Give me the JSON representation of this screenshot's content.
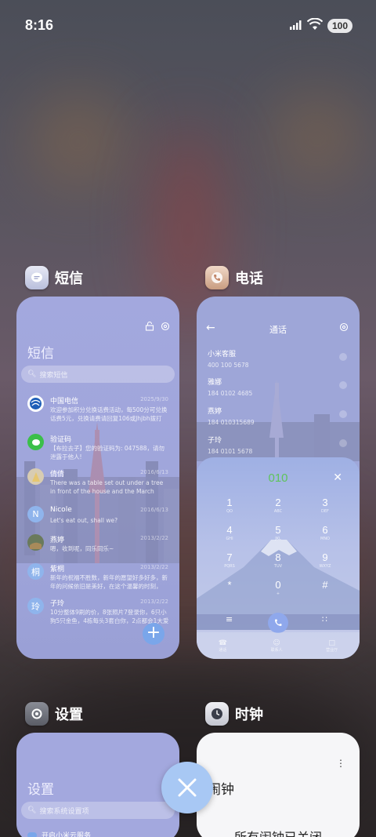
{
  "status_bar": {
    "time": "8:16",
    "battery": "100"
  },
  "apps": {
    "sms": {
      "name": "短信",
      "title": "短信",
      "search_placeholder": "搜索短信",
      "messages": [
        {
          "name": "中国电信",
          "date": "2025/9/30",
          "preview": "欢迎参加积分兑换话费活动，每500分可兑换话费5元，兑换请费请回复106或Jhjbh拨打",
          "avatar_text": "",
          "avatar_color": "#1f5fb8"
        },
        {
          "name": "验证码",
          "date": "",
          "preview": "【布拉去子】您的验证码为: 047588，请勿泄露于他人!",
          "avatar_text": "",
          "avatar_color": "#3bbf4a"
        },
        {
          "name": "倩倩",
          "date": "2016/6/13",
          "preview": "There was a table set out under a tree in front of the house and the March Hare and",
          "avatar_text": "",
          "avatar_color": "#c9b99b"
        },
        {
          "name": "Nicole",
          "date": "2016/6/13",
          "preview": "Let's eat out, shall we?",
          "avatar_text": "N",
          "avatar_color": "#8fb4ec"
        },
        {
          "name": "燕婷",
          "date": "2013/2/22",
          "preview": "嗯，收到呢，同乐同乐~",
          "avatar_text": "",
          "avatar_color": "#6a7a5c"
        },
        {
          "name": "紫桐",
          "date": "2013/2/22",
          "preview": "新年的祝福不胜数，新年的愿望好多好多，新年的问候依旧是美好，在这个温馨的时刻，",
          "avatar_text": "桐",
          "avatar_color": "#8fb4ec"
        },
        {
          "name": "子玲",
          "date": "2013/2/22",
          "preview": "10分整体9刷的价，8张照片7登录你，6只小狗5只金鱼，4栋每头3套白你，2点都会1大爱你",
          "avatar_text": "玲",
          "avatar_color": "#8fb4ec"
        }
      ]
    },
    "phone": {
      "name": "电话",
      "title": "通话",
      "contacts": [
        {
          "name": "小米客服",
          "number": "400 100 5678"
        },
        {
          "name": "雅娜",
          "number": "184 0102 4685"
        },
        {
          "name": "燕婷",
          "number": "184 010315689"
        },
        {
          "name": "子玲",
          "number": "184 0101 5678"
        }
      ],
      "dialed": "010",
      "keys": [
        {
          "digit": "1",
          "letters": "QO"
        },
        {
          "digit": "2",
          "letters": "ABC"
        },
        {
          "digit": "3",
          "letters": "DEF"
        },
        {
          "digit": "4",
          "letters": "GHI"
        },
        {
          "digit": "5",
          "letters": "JKL"
        },
        {
          "digit": "6",
          "letters": "MNO"
        },
        {
          "digit": "7",
          "letters": "PQRS"
        },
        {
          "digit": "8",
          "letters": "TUV"
        },
        {
          "digit": "9",
          "letters": "WXYZ"
        },
        {
          "digit": "*",
          "letters": ""
        },
        {
          "digit": "0",
          "letters": "+"
        },
        {
          "digit": "#",
          "letters": ""
        }
      ],
      "tabs": [
        "通话",
        "联系人",
        "营业厅"
      ]
    },
    "settings": {
      "name": "设置",
      "title": "设置",
      "search_placeholder": "搜索系统设置项",
      "first_item": "开启小米云服务"
    },
    "clock": {
      "name": "时钟",
      "title": "闹钟",
      "empty_text": "所有闹钟已关闭"
    }
  },
  "colors": {
    "accent": "#a8c8f4",
    "dial_green": "#5ec45b"
  }
}
